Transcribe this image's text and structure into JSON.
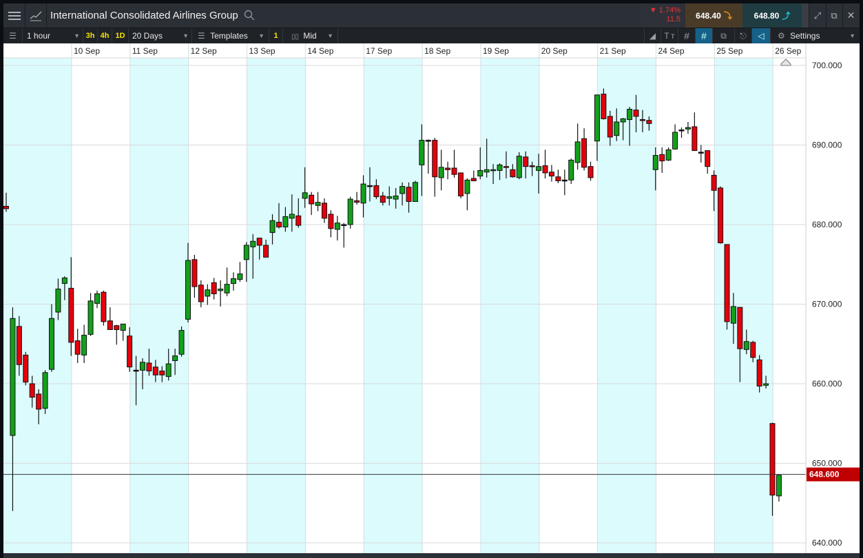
{
  "header": {
    "title": "International Consolidated Airlines Group",
    "change_percent": "▼ 1.74%",
    "change_points": "11.5",
    "sell_price": "648.40",
    "buy_price": "648.80"
  },
  "toolbar": {
    "interval": "1 hour",
    "quick_intervals": [
      "3h",
      "4h",
      "1D"
    ],
    "range": "20 Days",
    "templates": "Templates",
    "indicator_count": "1",
    "price_type": "Mid",
    "settings": "Settings"
  },
  "colors": {
    "up": "#13a01b",
    "down": "#e5000b",
    "shade": "#dcfbfd",
    "current_badge": "#c00000"
  },
  "chart_data": {
    "type": "candlestick",
    "title": "International Consolidated Airlines Group",
    "interval": "1 hour",
    "ylim": [
      640,
      700
    ],
    "yticks": [
      "700.000",
      "690.000",
      "680.000",
      "670.000",
      "660.000",
      "650.000",
      "640.000"
    ],
    "ytick_values": [
      700,
      690,
      680,
      670,
      660,
      650,
      640
    ],
    "current_price": 648.6,
    "current_price_label": "648.600",
    "date_labels": [
      "10 Sep",
      "11 Sep",
      "12 Sep",
      "13 Sep",
      "14 Sep",
      "17 Sep",
      "18 Sep",
      "19 Sep",
      "20 Sep",
      "21 Sep",
      "24 Sep",
      "25 Sep",
      "26 Sep"
    ],
    "date_label_start_index": 10,
    "candles_per_day": 9,
    "ohlc_format": [
      "open",
      "high",
      "low",
      "close"
    ],
    "candles": [
      [
        682.3,
        684,
        681.6,
        682.0
      ],
      [
        653.5,
        669.6,
        644,
        668.2
      ],
      [
        667.2,
        668.5,
        661,
        662.4
      ],
      [
        663.6,
        664,
        659.8,
        660.2
      ],
      [
        660,
        661,
        657,
        658.3
      ],
      [
        658.7,
        659.3,
        654.9,
        656.8
      ],
      [
        656.9,
        661.7,
        656.2,
        661.4
      ],
      [
        661.8,
        670,
        661.5,
        668.2
      ],
      [
        669,
        673.2,
        668,
        671.9
      ],
      [
        672.6,
        673.5,
        670.5,
        673.3
      ],
      [
        672,
        675.9,
        663.5,
        665.2
      ],
      [
        665.4,
        666.9,
        662.6,
        663.7
      ],
      [
        663.6,
        667.4,
        662.6,
        666.1
      ],
      [
        666.2,
        671.4,
        666,
        670.4
      ],
      [
        670.1,
        671.7,
        669.5,
        671.3
      ],
      [
        671.5,
        671.7,
        667.3,
        667.8
      ],
      [
        667.9,
        669.6,
        666.8,
        666.8
      ],
      [
        667.3,
        667.4,
        664.9,
        666.8
      ],
      [
        666.7,
        667.5,
        665.4,
        667.5
      ],
      [
        666,
        667.1,
        661.5,
        662.1
      ],
      [
        661.7,
        663.5,
        657.3,
        661.7
      ],
      [
        661.7,
        663.2,
        659.3,
        662.7
      ],
      [
        662.6,
        664.4,
        661,
        661.6
      ],
      [
        662.1,
        663,
        660.2,
        661.1
      ],
      [
        661.6,
        662.2,
        660.2,
        661.1
      ],
      [
        660.9,
        664.4,
        660.4,
        662.5
      ],
      [
        662.9,
        664.4,
        661.1,
        663.5
      ],
      [
        663.7,
        667.2,
        663.4,
        666.7
      ],
      [
        668.1,
        677.7,
        667.7,
        675.5
      ],
      [
        675.6,
        676.2,
        670.8,
        672.2
      ],
      [
        672.4,
        673,
        669.6,
        670.3
      ],
      [
        671,
        672.5,
        669.9,
        671.8
      ],
      [
        672.7,
        673.3,
        670.6,
        671.3
      ],
      [
        671.7,
        673,
        669.7,
        671.9
      ],
      [
        671.4,
        674.6,
        671,
        672.5
      ],
      [
        672.6,
        674,
        671.7,
        673.2
      ],
      [
        673.1,
        675.3,
        672.8,
        673.8
      ],
      [
        675.6,
        677.8,
        672.8,
        677.4
      ],
      [
        677.2,
        678.8,
        673.2,
        677.9
      ],
      [
        678.3,
        678.3,
        675.6,
        677.4
      ],
      [
        677.4,
        678.1,
        675.9,
        675.9
      ],
      [
        679,
        681.3,
        677.5,
        680.5
      ],
      [
        680.3,
        682.7,
        679.5,
        679.7
      ],
      [
        679.7,
        682.2,
        679.1,
        681
      ],
      [
        680.8,
        683.8,
        679.1,
        681.3
      ],
      [
        681.1,
        683.3,
        679.6,
        679.9
      ],
      [
        683.3,
        687.2,
        682.1,
        684
      ],
      [
        683.7,
        684.1,
        681.2,
        682.6
      ],
      [
        682.4,
        684.1,
        681.7,
        682.8
      ],
      [
        682.7,
        683.3,
        680.2,
        680.8
      ],
      [
        681.3,
        681.8,
        678.4,
        679.5
      ],
      [
        679.4,
        681.1,
        678,
        680.2
      ],
      [
        680,
        680.2,
        677.1,
        680
      ],
      [
        680,
        683.5,
        679.5,
        683.2
      ],
      [
        683,
        684.1,
        682.5,
        682.8
      ],
      [
        682.7,
        686.2,
        680.9,
        685.1
      ],
      [
        684.9,
        687.2,
        682.9,
        684.9
      ],
      [
        684.9,
        685.7,
        683.2,
        683.5
      ],
      [
        683.6,
        684.1,
        682.4,
        682.8
      ],
      [
        683.3,
        684.8,
        682.4,
        683.5
      ],
      [
        683.2,
        684.6,
        682,
        683.6
      ],
      [
        683.9,
        685.3,
        682.4,
        684.8
      ],
      [
        684.7,
        685.3,
        681.5,
        682.9
      ],
      [
        682.9,
        685.5,
        682.9,
        685.3
      ],
      [
        687.5,
        692.6,
        683.6,
        690.6
      ],
      [
        690.6,
        690.7,
        686.4,
        690.6
      ],
      [
        690.6,
        690.9,
        683.5,
        686
      ],
      [
        685.9,
        689.4,
        684.3,
        687.2
      ],
      [
        687.1,
        687.9,
        685.7,
        686.9
      ],
      [
        687.1,
        689.4,
        685.9,
        686.3
      ],
      [
        686.5,
        686.5,
        683.3,
        683.6
      ],
      [
        683.9,
        685.8,
        681.8,
        685.6
      ],
      [
        685.8,
        686.8,
        685.5,
        685.5
      ],
      [
        686.1,
        689.7,
        685.7,
        686.8
      ],
      [
        686.6,
        690.8,
        685.9,
        686.9
      ],
      [
        686.8,
        687.6,
        685.1,
        686.9
      ],
      [
        686.8,
        687.7,
        685.6,
        687.5
      ],
      [
        687.3,
        689.2,
        685.8,
        687.2
      ],
      [
        686.9,
        687.6,
        685.9,
        686
      ],
      [
        685.9,
        689.1,
        685.7,
        688.6
      ],
      [
        688.5,
        689.2,
        685.8,
        687.3
      ],
      [
        687.4,
        687.9,
        686.1,
        687.3
      ],
      [
        686.8,
        688.9,
        683.9,
        687.3
      ],
      [
        687.4,
        689.4,
        685.8,
        686.5
      ],
      [
        686.6,
        687.5,
        685.4,
        686.1
      ],
      [
        686,
        686.9,
        685.2,
        685.5
      ],
      [
        685.6,
        686.9,
        683.7,
        685.6
      ],
      [
        685.6,
        688.3,
        685.1,
        688.1
      ],
      [
        687.8,
        692.7,
        686.9,
        690.4
      ],
      [
        690.8,
        692.1,
        686.8,
        687.2
      ],
      [
        687.3,
        687.9,
        685.5,
        685.9
      ],
      [
        690.5,
        696.3,
        688,
        696.3
      ],
      [
        696.4,
        697.1,
        693.2,
        693.3
      ],
      [
        693.6,
        694.3,
        689.9,
        691
      ],
      [
        691.2,
        694.6,
        690.5,
        692.9
      ],
      [
        692.9,
        693.4,
        690.6,
        693.3
      ],
      [
        693.2,
        694.8,
        689.9,
        694.5
      ],
      [
        694.4,
        696.3,
        691.6,
        693.6
      ],
      [
        693.2,
        694.4,
        691.6,
        693.1
      ],
      [
        693.1,
        693.6,
        691.8,
        692.7
      ],
      [
        686.9,
        689.7,
        684.3,
        688.7
      ],
      [
        688.8,
        689.7,
        686.5,
        688
      ],
      [
        688.1,
        689.7,
        688,
        689.4
      ],
      [
        689.5,
        692.6,
        689.4,
        691.6
      ],
      [
        691.9,
        692.2,
        690.9,
        691.9
      ],
      [
        692,
        692.9,
        691.4,
        692.2
      ],
      [
        692.3,
        694.1,
        689.3,
        689.3
      ],
      [
        689.1,
        690,
        687.8,
        689.1
      ],
      [
        689.3,
        689.3,
        686.4,
        687.3
      ],
      [
        686.2,
        686.8,
        681.7,
        684.3
      ],
      [
        684.6,
        684.8,
        677.6,
        677.7
      ],
      [
        677.5,
        677.5,
        666.8,
        667.8
      ],
      [
        667.6,
        671.4,
        665,
        669.7
      ],
      [
        669.6,
        669.6,
        660.2,
        664.4
      ],
      [
        664.3,
        666.8,
        663.7,
        665.3
      ],
      [
        665.2,
        665.4,
        662.7,
        663.3
      ],
      [
        663,
        663.6,
        658.9,
        659.7
      ],
      [
        659.8,
        661,
        659.4,
        660
      ],
      [
        655,
        655.1,
        643.4,
        646
      ],
      [
        645.9,
        648.6,
        645.2,
        648.5
      ]
    ]
  }
}
